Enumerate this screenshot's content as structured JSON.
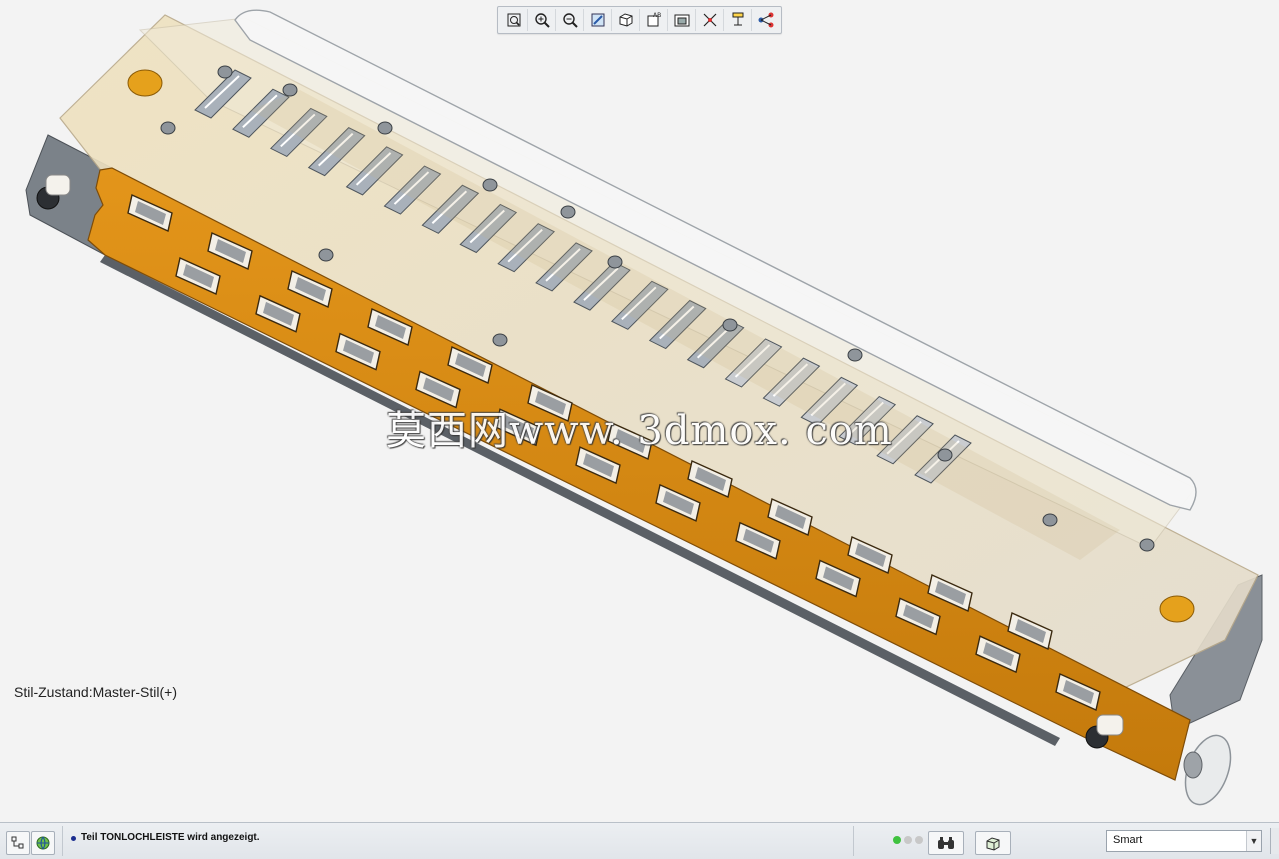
{
  "viewport": {
    "state_label": "Stil-Zustand:Master-Stil(+)",
    "watermark": "莫西网www. 3dmox. com",
    "background": "#f3f3f3"
  },
  "model": {
    "reed_count": 20,
    "upper_window_count": 12,
    "lower_window_count": 12,
    "colors": {
      "comb": "#d0860f",
      "comb_dark": "#8a5308",
      "cover": "#e9dfc6",
      "reed": "#a9b1ba",
      "metal": "#7f868d",
      "screw": "#e3a21a"
    }
  },
  "toolbar": {
    "buttons": [
      {
        "name": "refit-icon",
        "title": "Neu einpassen"
      },
      {
        "name": "zoom-in-icon",
        "title": "Vergrößern"
      },
      {
        "name": "zoom-out-icon",
        "title": "Verkleinern"
      },
      {
        "name": "repaint-icon",
        "title": "Neu zeichnen"
      },
      {
        "name": "display-style-icon",
        "title": "Darstellungsstil"
      },
      {
        "name": "saved-views-icon",
        "title": "Gespeicherte Ansichten"
      },
      {
        "name": "view-manager-icon",
        "title": "Ansichtsmanager"
      },
      {
        "name": "datum-display-icon",
        "title": "Bezugsanzeige"
      },
      {
        "name": "annotation-display-icon",
        "title": "Anmerkungsanzeige"
      },
      {
        "name": "spin-center-icon",
        "title": "Drehmittelpunkt"
      }
    ]
  },
  "statusbar": {
    "message": "Teil TONLOCHLEISTE wird angezeigt.",
    "filter": {
      "value": "Smart"
    },
    "lights": [
      "#3fc23f",
      "#c8c8c8",
      "#c8c8c8"
    ]
  }
}
